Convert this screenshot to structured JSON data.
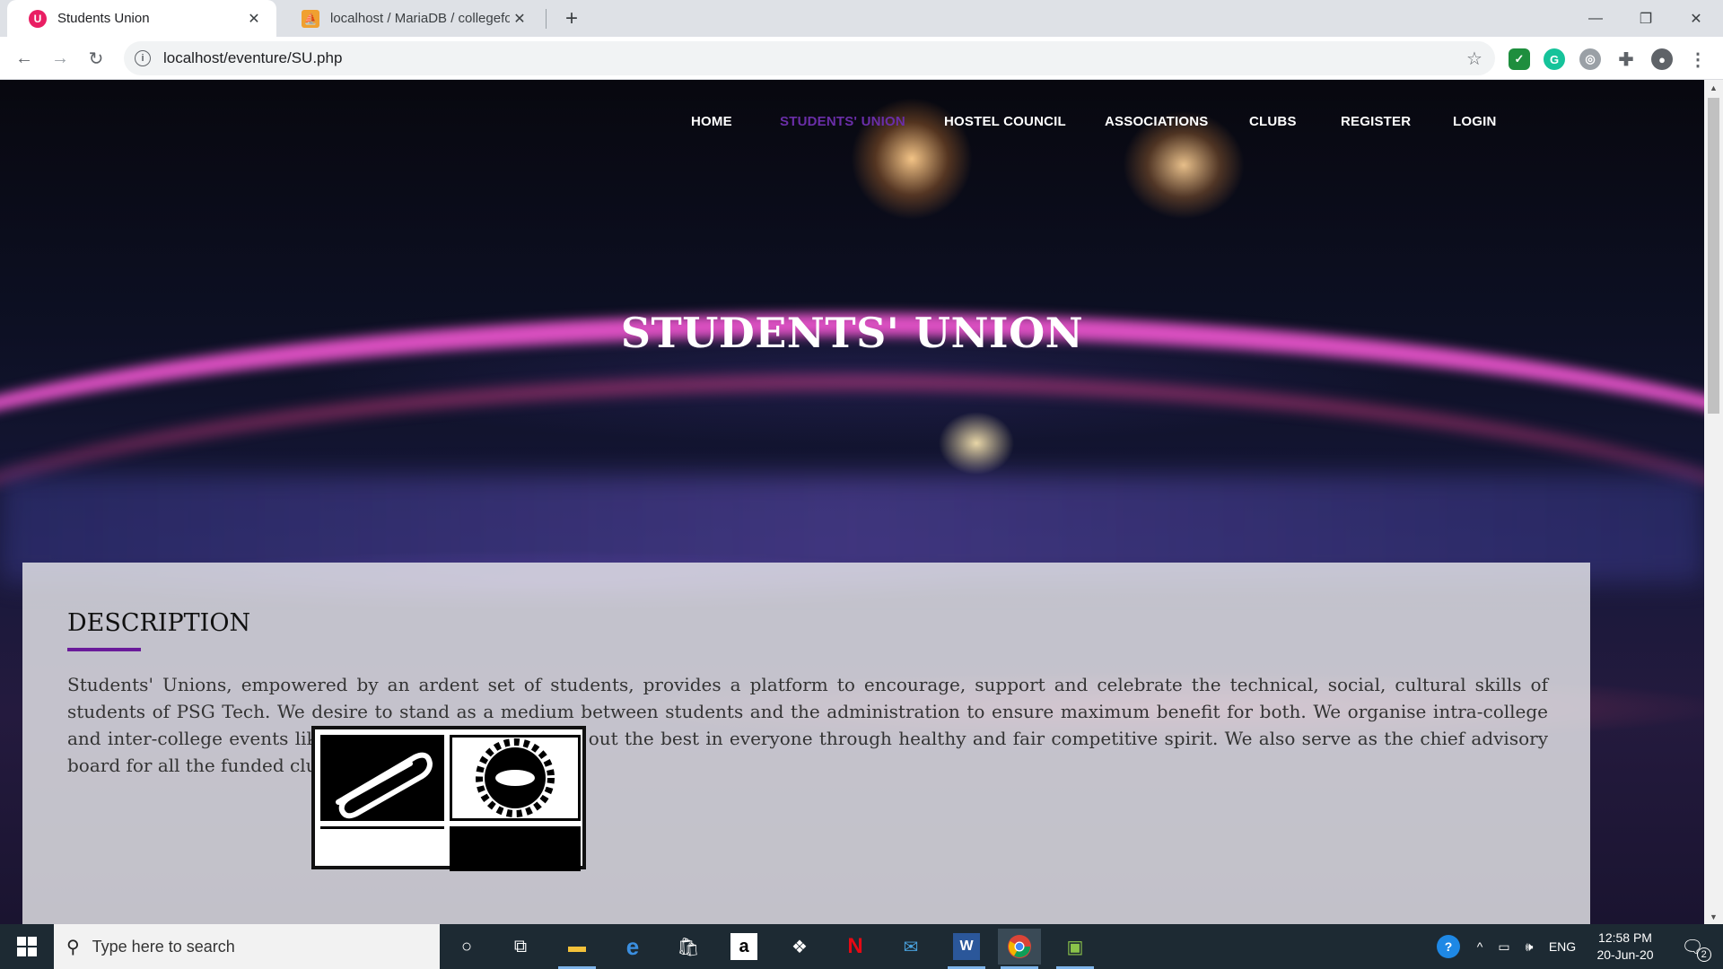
{
  "browser": {
    "tabs": [
      {
        "title": "Students Union",
        "active": true,
        "favicon_color": "#e91e63"
      },
      {
        "title": "localhost / MariaDB / collegeforu",
        "active": false,
        "favicon_color": "#f0a030"
      }
    ],
    "url": "localhost/eventure/SU.php"
  },
  "site": {
    "nav": {
      "home": "HOME",
      "students_union": "STUDENTS' UNION",
      "hostel_council": "HOSTEL COUNCIL",
      "associations": "ASSOCIATIONS",
      "clubs": "CLUBS",
      "register": "REGISTER",
      "login": "LOGIN"
    },
    "hero_title": "STUDENTS' UNION",
    "description": {
      "heading": "DESCRIPTION",
      "body": "Students' Unions, empowered by an ardent set of students, provides a platform to encourage, support and celebrate the technical, social, cultural skills of students of PSG Tech. We desire to stand as a medium between students and the administration to ensure maximum benefit for both. We organise intra-college and inter-college events like Shrishti and Kriya to bring out the best in everyone through healthy and fair competitive spirit. We also serve as the chief advisory board for all the funded clubs of the institution."
    },
    "accent_color": "#6a1b9a"
  },
  "taskbar": {
    "search_placeholder": "Type here to search",
    "language": "ENG",
    "time": "12:58 PM",
    "date": "20-Jun-20",
    "notification_count": "2"
  }
}
